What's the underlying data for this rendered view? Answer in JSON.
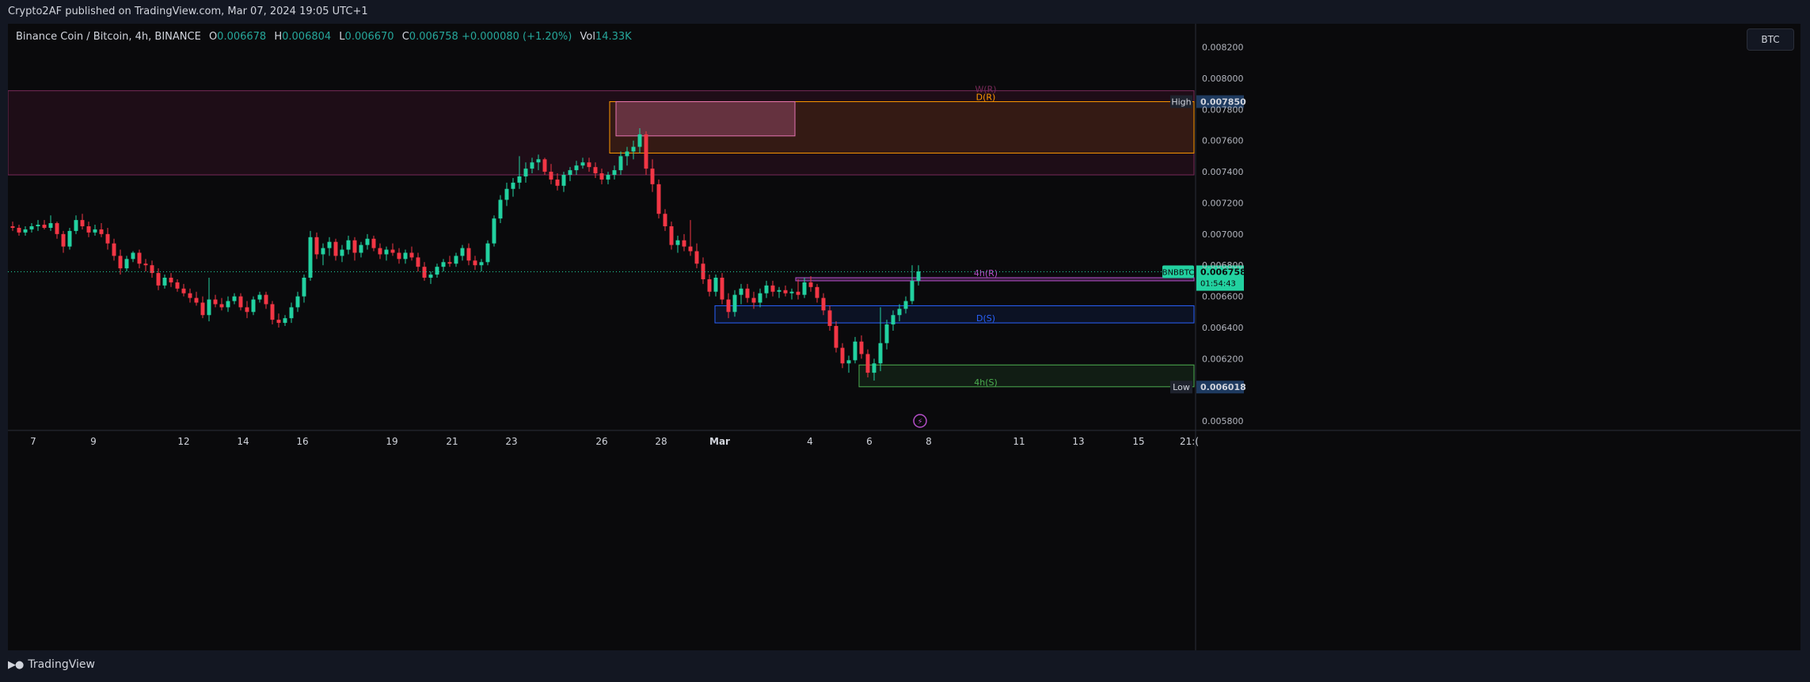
{
  "header": {
    "credit": "Crypto2AF published on TradingView.com, Mar 07, 2024 19:05 UTC+1"
  },
  "legend": {
    "symbol": "Binance Coin / Bitcoin, 4h, BINANCE",
    "open_label": "O",
    "open": "0.006678",
    "high_label": "H",
    "high": "0.006804",
    "low_label": "L",
    "low": "0.006670",
    "close_label": "C",
    "close": "0.006758",
    "change": "+0.000080 (+1.20%)",
    "vol_label": "Vol",
    "vol": "14.33K"
  },
  "currency_button": "BTC",
  "footer": {
    "brand": "TradingView"
  },
  "colors": {
    "up": "#22d1a0",
    "down": "#f23645",
    "background": "#0a0a0c",
    "price_label": "#22d1a0",
    "resistance_4h": "#b54fc9",
    "support_daily": "#2962ff",
    "support_4h": "#4caf50",
    "resistance_daily": "#ff9800"
  },
  "chart_data": {
    "type": "candlestick",
    "symbol": "BNBBTC",
    "interval": "4h",
    "x_tick_labels": [
      "7",
      "9",
      "12",
      "14",
      "16",
      "19",
      "21",
      "23",
      "26",
      "28",
      "Mar",
      "4",
      "6",
      "8",
      "11",
      "13",
      "15",
      "21:("
    ],
    "y_tick_labels": [
      "0.008200",
      "0.008000",
      "0.007800",
      "0.007600",
      "0.007400",
      "0.007200",
      "0.007000",
      "0.006800",
      "0.006600",
      "0.006400",
      "0.006200",
      "0.005800"
    ],
    "ylim": [
      0.00575,
      0.00835
    ],
    "current_price": {
      "symbol": "BNBBTC",
      "value": "0.006758",
      "countdown": "01:54:43"
    },
    "high_marker": {
      "label": "High",
      "value": "0.007850"
    },
    "low_marker": {
      "label": "Low",
      "value": "0.006018"
    },
    "zone_labels": [
      "W(R)",
      "D(R)",
      "4h(R)",
      "D(S)",
      "4h(S)"
    ],
    "zones": [
      {
        "label": "W(R)",
        "low": 0.00738,
        "high": 0.00792
      },
      {
        "label": "D(R)",
        "low": 0.00752,
        "high": 0.00785
      },
      {
        "label": "4h(R)",
        "low": 0.0067,
        "high": 0.00672
      },
      {
        "label": "D(S)",
        "low": 0.00643,
        "high": 0.00654
      },
      {
        "label": "4h(S)",
        "low": 0.00602,
        "high": 0.00616
      }
    ],
    "candles": [
      [
        0.00705,
        0.00708,
        0.00702,
        0.00704
      ],
      [
        0.00704,
        0.00706,
        0.00699,
        0.00701
      ],
      [
        0.00701,
        0.00705,
        0.00699,
        0.00703
      ],
      [
        0.00703,
        0.00707,
        0.00701,
        0.00705
      ],
      [
        0.00705,
        0.00709,
        0.00702,
        0.00706
      ],
      [
        0.00706,
        0.00709,
        0.00703,
        0.00704
      ],
      [
        0.00704,
        0.00712,
        0.00702,
        0.00707
      ],
      [
        0.00707,
        0.00708,
        0.00697,
        0.007
      ],
      [
        0.007,
        0.00702,
        0.00688,
        0.00692
      ],
      [
        0.00692,
        0.00704,
        0.0069,
        0.00702
      ],
      [
        0.00702,
        0.00712,
        0.007,
        0.00709
      ],
      [
        0.00709,
        0.00713,
        0.00703,
        0.00705
      ],
      [
        0.00705,
        0.00708,
        0.00698,
        0.00701
      ],
      [
        0.00701,
        0.00706,
        0.00699,
        0.00703
      ],
      [
        0.00703,
        0.00707,
        0.00698,
        0.007
      ],
      [
        0.007,
        0.00704,
        0.0069,
        0.00694
      ],
      [
        0.00694,
        0.00697,
        0.00683,
        0.00686
      ],
      [
        0.00686,
        0.0069,
        0.00674,
        0.00678
      ],
      [
        0.00678,
        0.00686,
        0.00676,
        0.00684
      ],
      [
        0.00684,
        0.00689,
        0.00682,
        0.00688
      ],
      [
        0.00688,
        0.0069,
        0.00678,
        0.00681
      ],
      [
        0.00681,
        0.00684,
        0.00676,
        0.0068
      ],
      [
        0.0068,
        0.00683,
        0.00672,
        0.00675
      ],
      [
        0.00675,
        0.00678,
        0.00664,
        0.00667
      ],
      [
        0.00667,
        0.00674,
        0.00665,
        0.00672
      ],
      [
        0.00672,
        0.00675,
        0.00666,
        0.00669
      ],
      [
        0.00669,
        0.00671,
        0.00663,
        0.00665
      ],
      [
        0.00665,
        0.00668,
        0.0066,
        0.00662
      ],
      [
        0.00662,
        0.00665,
        0.00656,
        0.00659
      ],
      [
        0.00659,
        0.00663,
        0.00654,
        0.00656
      ],
      [
        0.00656,
        0.0066,
        0.00646,
        0.00648
      ],
      [
        0.00648,
        0.00672,
        0.00644,
        0.00658
      ],
      [
        0.00658,
        0.00661,
        0.00653,
        0.00655
      ],
      [
        0.00655,
        0.00659,
        0.00651,
        0.00653
      ],
      [
        0.00653,
        0.0066,
        0.0065,
        0.00657
      ],
      [
        0.00657,
        0.00662,
        0.00655,
        0.0066
      ],
      [
        0.0066,
        0.00662,
        0.00651,
        0.00653
      ],
      [
        0.00653,
        0.00657,
        0.00646,
        0.0065
      ],
      [
        0.0065,
        0.0066,
        0.00648,
        0.00658
      ],
      [
        0.00658,
        0.00663,
        0.00656,
        0.00661
      ],
      [
        0.00661,
        0.00663,
        0.00652,
        0.00655
      ],
      [
        0.00655,
        0.00657,
        0.00642,
        0.00645
      ],
      [
        0.00645,
        0.00649,
        0.0064,
        0.00643
      ],
      [
        0.00643,
        0.00648,
        0.00641,
        0.00646
      ],
      [
        0.00646,
        0.00656,
        0.00643,
        0.00653
      ],
      [
        0.00653,
        0.00663,
        0.0065,
        0.0066
      ],
      [
        0.0066,
        0.00674,
        0.00656,
        0.00672
      ],
      [
        0.00672,
        0.00702,
        0.0067,
        0.00698
      ],
      [
        0.00698,
        0.00701,
        0.00684,
        0.00687
      ],
      [
        0.00687,
        0.00694,
        0.0068,
        0.00691
      ],
      [
        0.00691,
        0.00698,
        0.00686,
        0.00695
      ],
      [
        0.00695,
        0.00697,
        0.00683,
        0.00686
      ],
      [
        0.00686,
        0.00693,
        0.00682,
        0.0069
      ],
      [
        0.0069,
        0.00699,
        0.00687,
        0.00696
      ],
      [
        0.00696,
        0.00698,
        0.00683,
        0.00688
      ],
      [
        0.00688,
        0.00695,
        0.00685,
        0.00693
      ],
      [
        0.00693,
        0.007,
        0.0069,
        0.00697
      ],
      [
        0.00697,
        0.00699,
        0.00689,
        0.00691
      ],
      [
        0.00691,
        0.00694,
        0.00684,
        0.00687
      ],
      [
        0.00687,
        0.00692,
        0.00683,
        0.0069
      ],
      [
        0.0069,
        0.00694,
        0.00686,
        0.00688
      ],
      [
        0.00688,
        0.00691,
        0.00681,
        0.00684
      ],
      [
        0.00684,
        0.0069,
        0.00681,
        0.00688
      ],
      [
        0.00688,
        0.00692,
        0.00683,
        0.00685
      ],
      [
        0.00685,
        0.00688,
        0.00676,
        0.00679
      ],
      [
        0.00679,
        0.00682,
        0.0067,
        0.00672
      ],
      [
        0.00672,
        0.00676,
        0.00668,
        0.00674
      ],
      [
        0.00674,
        0.00681,
        0.00672,
        0.00679
      ],
      [
        0.00679,
        0.00684,
        0.00676,
        0.00682
      ],
      [
        0.00682,
        0.00686,
        0.00679,
        0.00681
      ],
      [
        0.00681,
        0.00688,
        0.00679,
        0.00686
      ],
      [
        0.00686,
        0.00693,
        0.00683,
        0.00691
      ],
      [
        0.00691,
        0.00694,
        0.0068,
        0.00683
      ],
      [
        0.00683,
        0.00686,
        0.00677,
        0.0068
      ],
      [
        0.0068,
        0.00684,
        0.00676,
        0.00682
      ],
      [
        0.00682,
        0.00696,
        0.0068,
        0.00694
      ],
      [
        0.00694,
        0.00712,
        0.00692,
        0.0071
      ],
      [
        0.0071,
        0.00725,
        0.00707,
        0.00722
      ],
      [
        0.00722,
        0.00733,
        0.00718,
        0.00729
      ],
      [
        0.00729,
        0.00736,
        0.00724,
        0.00733
      ],
      [
        0.00733,
        0.0075,
        0.00729,
        0.00737
      ],
      [
        0.00737,
        0.00746,
        0.00733,
        0.00742
      ],
      [
        0.00742,
        0.00749,
        0.00739,
        0.00746
      ],
      [
        0.00746,
        0.00751,
        0.00741,
        0.00748
      ],
      [
        0.00748,
        0.00749,
        0.00738,
        0.0074
      ],
      [
        0.0074,
        0.00745,
        0.00732,
        0.00735
      ],
      [
        0.00735,
        0.00739,
        0.00728,
        0.00731
      ],
      [
        0.00731,
        0.0074,
        0.00727,
        0.00738
      ],
      [
        0.00738,
        0.00743,
        0.00734,
        0.00741
      ],
      [
        0.00741,
        0.00747,
        0.00738,
        0.00744
      ],
      [
        0.00744,
        0.00749,
        0.00742,
        0.00746
      ],
      [
        0.00746,
        0.00749,
        0.0074,
        0.00743
      ],
      [
        0.00743,
        0.00746,
        0.00736,
        0.00739
      ],
      [
        0.00739,
        0.00742,
        0.00732,
        0.00735
      ],
      [
        0.00735,
        0.0074,
        0.00732,
        0.00738
      ],
      [
        0.00738,
        0.00744,
        0.00735,
        0.00741
      ],
      [
        0.00741,
        0.00753,
        0.00738,
        0.0075
      ],
      [
        0.0075,
        0.00756,
        0.00744,
        0.00753
      ],
      [
        0.00753,
        0.0076,
        0.00748,
        0.00756
      ],
      [
        0.00756,
        0.00768,
        0.00752,
        0.00764
      ],
      [
        0.00764,
        0.00766,
        0.00738,
        0.00742
      ],
      [
        0.00742,
        0.00748,
        0.00727,
        0.00732
      ],
      [
        0.00732,
        0.00735,
        0.0071,
        0.00713
      ],
      [
        0.00713,
        0.00716,
        0.00702,
        0.00705
      ],
      [
        0.00705,
        0.00708,
        0.0069,
        0.00693
      ],
      [
        0.00693,
        0.00699,
        0.00688,
        0.00696
      ],
      [
        0.00696,
        0.007,
        0.00689,
        0.00692
      ],
      [
        0.00692,
        0.00709,
        0.00686,
        0.00689
      ],
      [
        0.00689,
        0.00694,
        0.00678,
        0.00681
      ],
      [
        0.00681,
        0.00685,
        0.00668,
        0.00671
      ],
      [
        0.00671,
        0.00674,
        0.0066,
        0.00663
      ],
      [
        0.00663,
        0.00674,
        0.0066,
        0.00672
      ],
      [
        0.00672,
        0.00675,
        0.00655,
        0.00658
      ],
      [
        0.00658,
        0.00662,
        0.00646,
        0.0065
      ],
      [
        0.0065,
        0.00664,
        0.00647,
        0.00661
      ],
      [
        0.00661,
        0.00668,
        0.00655,
        0.00665
      ],
      [
        0.00665,
        0.00668,
        0.00656,
        0.00659
      ],
      [
        0.00659,
        0.00663,
        0.00652,
        0.00656
      ],
      [
        0.00656,
        0.00665,
        0.00653,
        0.00662
      ],
      [
        0.00662,
        0.0067,
        0.00659,
        0.00667
      ],
      [
        0.00667,
        0.0067,
        0.0066,
        0.00663
      ],
      [
        0.00663,
        0.00666,
        0.00659,
        0.00664
      ],
      [
        0.00664,
        0.00667,
        0.0066,
        0.00662
      ],
      [
        0.00662,
        0.00665,
        0.00658,
        0.00663
      ],
      [
        0.00663,
        0.00671,
        0.00658,
        0.00661
      ],
      [
        0.00661,
        0.00672,
        0.00659,
        0.00669
      ],
      [
        0.00669,
        0.00673,
        0.00663,
        0.00666
      ],
      [
        0.00666,
        0.00668,
        0.00656,
        0.00659
      ],
      [
        0.00659,
        0.00662,
        0.00648,
        0.00651
      ],
      [
        0.00651,
        0.00654,
        0.00638,
        0.00641
      ],
      [
        0.00641,
        0.00644,
        0.00624,
        0.00627
      ],
      [
        0.00627,
        0.0063,
        0.00614,
        0.00617
      ],
      [
        0.00617,
        0.00622,
        0.00611,
        0.00619
      ],
      [
        0.00619,
        0.00634,
        0.00617,
        0.00631
      ],
      [
        0.00631,
        0.00635,
        0.0062,
        0.00623
      ],
      [
        0.00623,
        0.00626,
        0.00608,
        0.00611
      ],
      [
        0.00611,
        0.0062,
        0.00606,
        0.00617
      ],
      [
        0.00617,
        0.00653,
        0.00612,
        0.0063
      ],
      [
        0.0063,
        0.00645,
        0.00626,
        0.00642
      ],
      [
        0.00642,
        0.00651,
        0.00638,
        0.00648
      ],
      [
        0.00648,
        0.00655,
        0.00644,
        0.00652
      ],
      [
        0.00652,
        0.0066,
        0.00649,
        0.00657
      ],
      [
        0.00657,
        0.0068,
        0.00655,
        0.0067
      ],
      [
        0.0067,
        0.0068,
        0.00667,
        0.00676
      ]
    ]
  }
}
